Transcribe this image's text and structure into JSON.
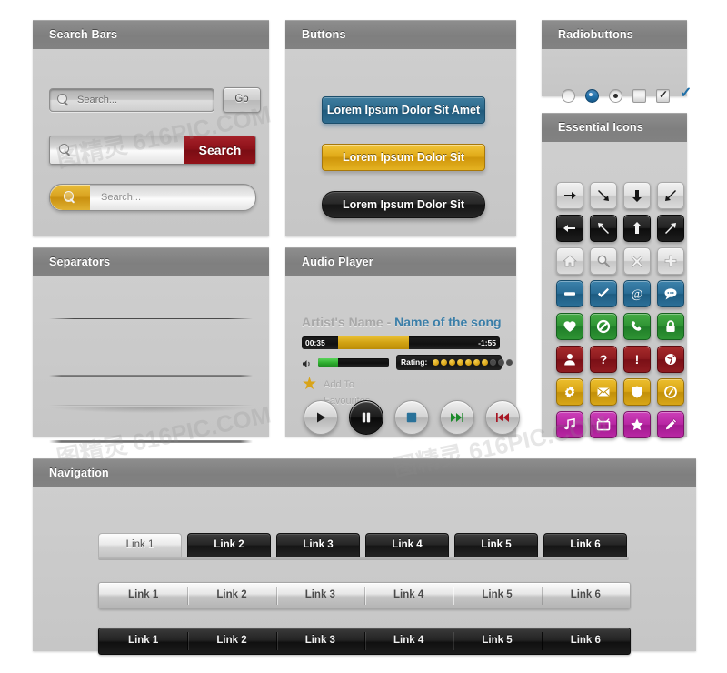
{
  "panels": {
    "search": {
      "title": "Search Bars",
      "bar1": {
        "placeholder": "Search...",
        "button": "Go",
        "icon": "magnifier-icon"
      },
      "bar2": {
        "placeholder": "",
        "button": "Search",
        "icon": "magnifier-icon",
        "accent": "#8d1119"
      },
      "bar3": {
        "placeholder": "Search...",
        "icon": "magnifier-icon",
        "accent": "#d9a321"
      }
    },
    "buttons": {
      "title": "Buttons",
      "items": [
        {
          "label": "Lorem Ipsum Dolor Sit Amet",
          "style": "blue",
          "color": "#2d6a8c"
        },
        {
          "label": "Lorem Ipsum Dolor Sit",
          "style": "gold",
          "color": "#e0aa18"
        },
        {
          "label": "Lorem Ipsum Dolor Sit",
          "style": "dark",
          "color": "#1c1c1c"
        }
      ]
    },
    "radiobuttons": {
      "title": "Radiobuttons",
      "controls": [
        {
          "name": "radio-unselected",
          "type": "radio",
          "state": "off"
        },
        {
          "name": "radio-selected-blue",
          "type": "radio",
          "state": "on",
          "color": "#1f6fa8"
        },
        {
          "name": "radio-selected-dark",
          "type": "radio",
          "state": "on",
          "color": "#2b2b2b"
        },
        {
          "name": "checkbox-unchecked",
          "type": "checkbox",
          "state": "off"
        },
        {
          "name": "checkbox-checked",
          "type": "checkbox",
          "state": "on",
          "color": "#2b2b2b"
        },
        {
          "name": "checkmark-blue",
          "type": "check",
          "state": "on",
          "color": "#1f6fa8"
        }
      ]
    },
    "icons": {
      "title": "Essential Icons",
      "items": [
        {
          "name": "arrow-right-icon",
          "tone": "grey"
        },
        {
          "name": "arrow-down-right-icon",
          "tone": "grey"
        },
        {
          "name": "arrow-down-icon",
          "tone": "grey"
        },
        {
          "name": "arrow-down-left-icon",
          "tone": "grey"
        },
        {
          "name": "arrow-left-icon",
          "tone": "black"
        },
        {
          "name": "arrow-up-left-icon",
          "tone": "black"
        },
        {
          "name": "arrow-up-icon",
          "tone": "black"
        },
        {
          "name": "arrow-up-right-icon",
          "tone": "black"
        },
        {
          "name": "home-icon",
          "tone": "grey"
        },
        {
          "name": "search-icon",
          "tone": "grey"
        },
        {
          "name": "close-icon",
          "tone": "grey"
        },
        {
          "name": "plus-icon",
          "tone": "grey"
        },
        {
          "name": "minus-icon",
          "tone": "blue"
        },
        {
          "name": "check-icon",
          "tone": "blue"
        },
        {
          "name": "at-sign-icon",
          "tone": "blue"
        },
        {
          "name": "chat-bubble-icon",
          "tone": "blue"
        },
        {
          "name": "heart-icon",
          "tone": "green"
        },
        {
          "name": "no-entry-icon",
          "tone": "green"
        },
        {
          "name": "phone-icon",
          "tone": "green"
        },
        {
          "name": "lock-icon",
          "tone": "green"
        },
        {
          "name": "user-icon",
          "tone": "red"
        },
        {
          "name": "question-mark-icon",
          "tone": "red"
        },
        {
          "name": "exclamation-mark-icon",
          "tone": "red"
        },
        {
          "name": "globe-icon",
          "tone": "red"
        },
        {
          "name": "gear-icon",
          "tone": "gold"
        },
        {
          "name": "envelope-icon",
          "tone": "gold"
        },
        {
          "name": "shield-icon",
          "tone": "gold"
        },
        {
          "name": "clock-icon",
          "tone": "gold"
        },
        {
          "name": "music-note-icon",
          "tone": "magenta"
        },
        {
          "name": "television-icon",
          "tone": "magenta"
        },
        {
          "name": "star-icon",
          "tone": "magenta"
        },
        {
          "name": "pencil-icon",
          "tone": "magenta"
        }
      ]
    },
    "separators": {
      "title": "Separators",
      "styles": [
        "thin-dark",
        "thin-light",
        "thick-dark",
        "soft-glow",
        "thick-dark",
        "soft-glow"
      ]
    },
    "audio": {
      "title": "Audio Player",
      "artist": "Artist's Name - ",
      "song": "Name of the song",
      "elapsed": "00:35",
      "remaining": "-1:55",
      "progress_percent": 36,
      "volume_percent": 28,
      "rating_label": "Rating:",
      "rating_filled": 7,
      "rating_total": 10,
      "favourites_label": "Add To Favourites",
      "controls": [
        {
          "name": "play-button",
          "glyph": "play"
        },
        {
          "name": "pause-button",
          "glyph": "pause"
        },
        {
          "name": "stop-button",
          "glyph": "stop"
        },
        {
          "name": "next-track-button",
          "glyph": "next"
        },
        {
          "name": "previous-track-button",
          "glyph": "previous"
        }
      ]
    },
    "navigation": {
      "title": "Navigation",
      "tabs": [
        {
          "label": "Link 1",
          "active": true
        },
        {
          "label": "Link 2",
          "active": false
        },
        {
          "label": "Link 3",
          "active": false
        },
        {
          "label": "Link 4",
          "active": false
        },
        {
          "label": "Link 5",
          "active": false
        },
        {
          "label": "Link 6",
          "active": false
        }
      ],
      "light_bar": [
        "Link 1",
        "Link 2",
        "Link 3",
        "Link 4",
        "Link 5",
        "Link 6"
      ],
      "dark_bar": [
        "Link 1",
        "Link 2",
        "Link 3",
        "Link 4",
        "Link 5",
        "Link 6"
      ]
    }
  },
  "watermarks": [
    "图精灵 616PIC.COM",
    "图精灵 616PIC.COM",
    "图精灵 616PIC.COM"
  ]
}
